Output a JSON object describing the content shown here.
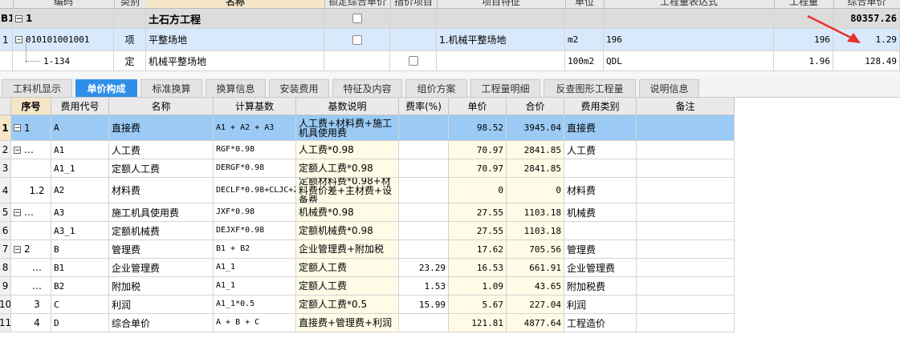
{
  "top_grid": {
    "headers": [
      "编码",
      "类别",
      "名称",
      "锁定综合单价",
      "指价项目",
      "项目特征",
      "单位",
      "工程量表达式",
      "工程量",
      "综合单价"
    ],
    "rows": [
      {
        "row_num": "B1",
        "code": "1",
        "type": "",
        "name": "土石方工程",
        "feature": "",
        "unit": "",
        "expr": "",
        "qty": "",
        "price": "80357.26"
      },
      {
        "row_num": "1",
        "code": "010101001001",
        "type": "项",
        "name": "平整场地",
        "feature": "1.机械平整场地",
        "unit": "m2",
        "expr": "196",
        "qty": "196",
        "price": "1.29"
      },
      {
        "row_num": "",
        "code": "1-134",
        "type": "定",
        "name": "机械平整场地",
        "feature": "",
        "unit": "100m2",
        "expr": "QDL",
        "qty": "1.96",
        "price": "128.49"
      }
    ]
  },
  "tabs": [
    "工料机显示",
    "单价构成",
    "标准换算",
    "换算信息",
    "安装费用",
    "特征及内容",
    "组价方案",
    "工程量明细",
    "反查图形工程量",
    "说明信息"
  ],
  "active_tab": "单价构成",
  "bottom_grid": {
    "headers": [
      "序号",
      "费用代号",
      "名称",
      "计算基数",
      "基数说明",
      "费率(%)",
      "单价",
      "合价",
      "费用类别",
      "备注"
    ],
    "rows": [
      {
        "n": "1",
        "seq": "1",
        "code": "A",
        "name": "直接费",
        "base": "A1 + A2 + A3",
        "desc": "人工费+材料费+施工机具使用费",
        "rate": "",
        "unit_price": "98.52",
        "total": "3945.04",
        "category": "直接费"
      },
      {
        "n": "2",
        "seq": "…",
        "code": "A1",
        "name": "人工费",
        "base": "RGF*0.98",
        "desc": "人工费*0.98",
        "rate": "",
        "unit_price": "70.97",
        "total": "2841.85",
        "category": "人工费"
      },
      {
        "n": "3",
        "seq": "",
        "code": "A1_1",
        "name": "定额人工费",
        "base": "DERGF*0.98",
        "desc": "定额人工费*0.98",
        "rate": "",
        "unit_price": "70.97",
        "total": "2841.85",
        "category": ""
      },
      {
        "n": "4",
        "seq": "1.2",
        "code": "A2",
        "name": "材料费",
        "base": "DECLF*0.98+CLJC+ZCF+SBF",
        "desc": "定额材料费*0.98+材料费价差+主材费+设备费",
        "rate": "",
        "unit_price": "0",
        "total": "0",
        "category": "材料费"
      },
      {
        "n": "5",
        "seq": "…",
        "code": "A3",
        "name": "施工机具使用费",
        "base": "JXF*0.98",
        "desc": "机械费*0.98",
        "rate": "",
        "unit_price": "27.55",
        "total": "1103.18",
        "category": "机械费"
      },
      {
        "n": "6",
        "seq": "",
        "code": "A3_1",
        "name": "定额机械费",
        "base": "DEJXF*0.98",
        "desc": "定额机械费*0.98",
        "rate": "",
        "unit_price": "27.55",
        "total": "1103.18",
        "category": ""
      },
      {
        "n": "7",
        "seq": "2",
        "code": "B",
        "name": "管理费",
        "base": "B1 + B2",
        "desc": "企业管理费+附加税",
        "rate": "",
        "unit_price": "17.62",
        "total": "705.56",
        "category": "管理费"
      },
      {
        "n": "8",
        "seq": "…",
        "code": "B1",
        "name": "企业管理费",
        "base": "A1_1",
        "desc": "定额人工费",
        "rate": "23.29",
        "unit_price": "16.53",
        "total": "661.91",
        "category": "企业管理费"
      },
      {
        "n": "9",
        "seq": "…",
        "code": "B2",
        "name": "附加税",
        "base": "A1_1",
        "desc": "定额人工费",
        "rate": "1.53",
        "unit_price": "1.09",
        "total": "43.65",
        "category": "附加税费"
      },
      {
        "n": "10",
        "seq": "3",
        "code": "C",
        "name": "利润",
        "base": "A1_1*0.5",
        "desc": "定额人工费*0.5",
        "rate": "15.99",
        "unit_price": "5.67",
        "total": "227.04",
        "category": "利润"
      },
      {
        "n": "11",
        "seq": "4",
        "code": "D",
        "name": "综合单价",
        "base": "A + B + C",
        "desc": "直接费+管理费+利润",
        "rate": "",
        "unit_price": "121.81",
        "total": "4877.64",
        "category": "工程造价"
      }
    ]
  },
  "colors": {
    "accent": "#2f8fe8",
    "selected_row": "#9bcbf5",
    "annotation_arrow": "#e8302a"
  }
}
